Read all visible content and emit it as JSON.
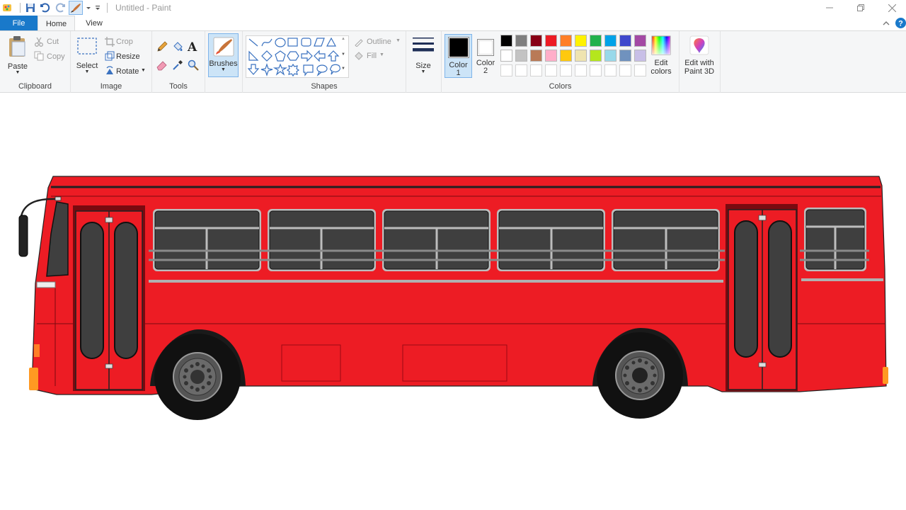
{
  "window": {
    "title": "Untitled - Paint"
  },
  "tabs": {
    "file": "File",
    "home": "Home",
    "view": "View"
  },
  "clipboard": {
    "paste": "Paste",
    "cut": "Cut",
    "copy": "Copy",
    "group_label": "Clipboard"
  },
  "image": {
    "select": "Select",
    "crop": "Crop",
    "resize": "Resize",
    "rotate": "Rotate",
    "group_label": "Image"
  },
  "tools": {
    "group_label": "Tools",
    "text_tool_glyph": "A"
  },
  "brushes": {
    "label": "Brushes"
  },
  "shapes": {
    "outline": "Outline",
    "fill": "Fill",
    "group_label": "Shapes"
  },
  "size": {
    "label": "Size"
  },
  "colors": {
    "color1_label": "Color",
    "color1_num": "1",
    "color2_label": "Color",
    "color2_num": "2",
    "color1_value": "#000000",
    "color2_value": "#ffffff",
    "edit_colors_line1": "Edit",
    "edit_colors_line2": "colors",
    "group_label": "Colors",
    "palette_row1": [
      "#000000",
      "#7f7f7f",
      "#880015",
      "#ed1c24",
      "#ff7f27",
      "#fff200",
      "#22b14c",
      "#00a2e8",
      "#3f48cc",
      "#a349a4"
    ],
    "palette_row2": [
      "#ffffff",
      "#c3c3c3",
      "#b97a57",
      "#ffaec9",
      "#ffc90e",
      "#efe4b0",
      "#b5e61d",
      "#99d9ea",
      "#7092be",
      "#c8bfe7"
    ],
    "palette_row3": [
      "#ffffff",
      "#ffffff",
      "#ffffff",
      "#ffffff",
      "#ffffff",
      "#ffffff",
      "#ffffff",
      "#ffffff",
      "#ffffff",
      "#ffffff"
    ]
  },
  "paint3d": {
    "line1": "Edit with",
    "line2": "Paint 3D"
  },
  "drawing": {
    "subject": "red-bus",
    "body_color": "#ed1c24",
    "window_color": "#3f3f3f",
    "tire_color": "#111111"
  }
}
